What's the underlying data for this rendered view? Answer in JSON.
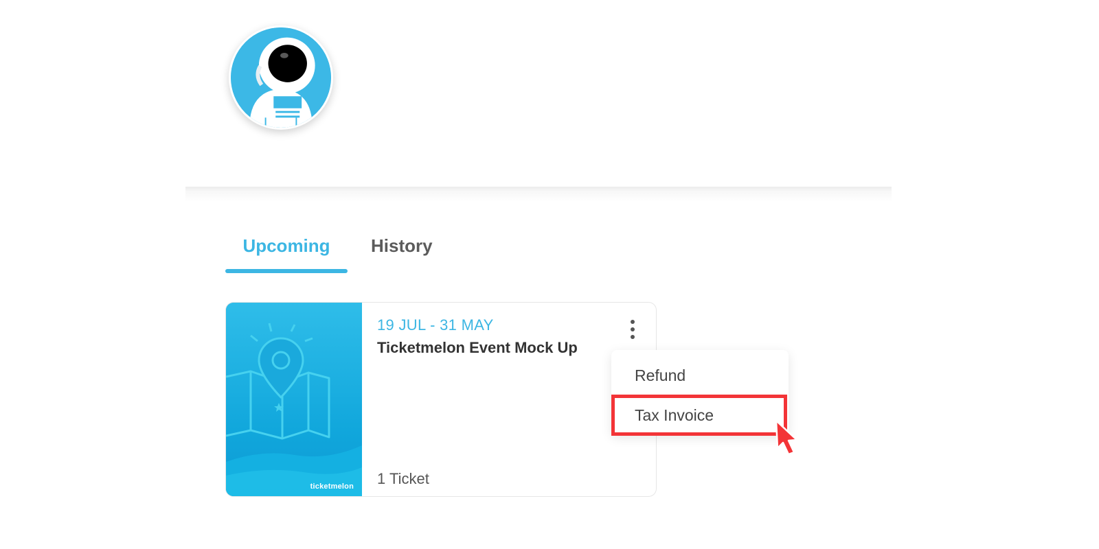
{
  "profile": {
    "avatar_icon": "astronaut-avatar-icon"
  },
  "tabs": [
    {
      "label": "Upcoming",
      "active": true
    },
    {
      "label": "History",
      "active": false
    }
  ],
  "event_card": {
    "date_range": "19 JUL - 31 MAY",
    "title": "Ticketmelon Event Mock Up",
    "ticket_count": "1 Ticket",
    "brand": "ticketmelon",
    "image_icon": "map-pin-icon",
    "menu_icon": "more-vertical-icon"
  },
  "menu": {
    "items": [
      {
        "label": "Refund"
      },
      {
        "label": "Tax Invoice",
        "highlighted": true
      }
    ]
  },
  "colors": {
    "accent": "#3cb6e3",
    "highlight": "#f33437",
    "text": "#333333",
    "muted": "#555555"
  }
}
